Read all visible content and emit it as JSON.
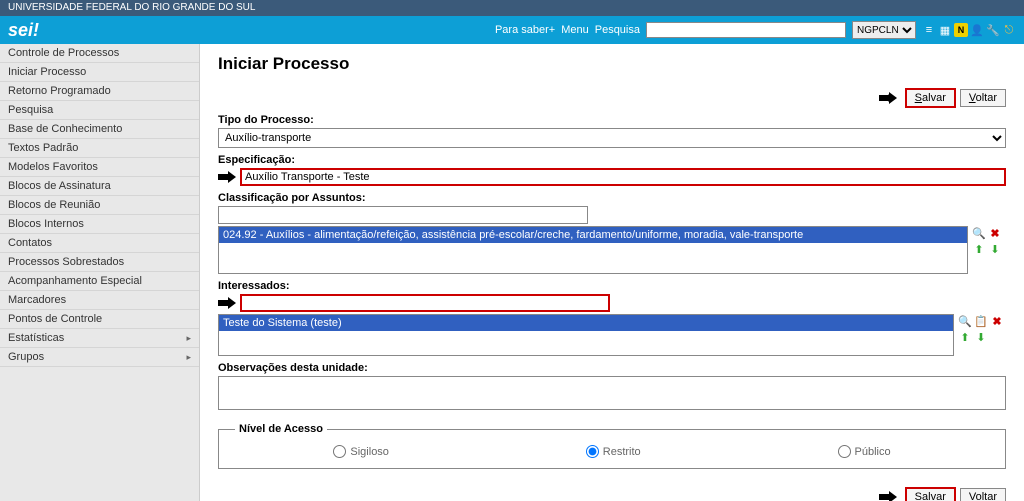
{
  "top_bar": "UNIVERSIDADE FEDERAL DO RIO GRANDE DO SUL",
  "logo": "sei",
  "header": {
    "para_saber": "Para saber+",
    "menu": "Menu",
    "pesquisa": "Pesquisa",
    "user": "NGPCLN"
  },
  "sidebar": {
    "items": [
      {
        "label": "Controle de Processos",
        "expand": false
      },
      {
        "label": "Iniciar Processo",
        "expand": false
      },
      {
        "label": "Retorno Programado",
        "expand": false
      },
      {
        "label": "Pesquisa",
        "expand": false
      },
      {
        "label": "Base de Conhecimento",
        "expand": false
      },
      {
        "label": "Textos Padrão",
        "expand": false
      },
      {
        "label": "Modelos Favoritos",
        "expand": false
      },
      {
        "label": "Blocos de Assinatura",
        "expand": false
      },
      {
        "label": "Blocos de Reunião",
        "expand": false
      },
      {
        "label": "Blocos Internos",
        "expand": false
      },
      {
        "label": "Contatos",
        "expand": false
      },
      {
        "label": "Processos Sobrestados",
        "expand": false
      },
      {
        "label": "Acompanhamento Especial",
        "expand": false
      },
      {
        "label": "Marcadores",
        "expand": false
      },
      {
        "label": "Pontos de Controle",
        "expand": false
      },
      {
        "label": "Estatísticas",
        "expand": true
      },
      {
        "label": "Grupos",
        "expand": true
      }
    ]
  },
  "main": {
    "title": "Iniciar Processo",
    "salvar": "Salvar",
    "voltar": "Voltar",
    "tipo_label": "Tipo do Processo:",
    "tipo_value": "Auxílio-transporte",
    "espec_label": "Especificação:",
    "espec_value": "Auxílio Transporte - Teste",
    "classif_label": "Classificação por Assuntos:",
    "classif_item": "024.92 - Auxílios - alimentação/refeição, assistência pré-escolar/creche, fardamento/uniforme, moradia, vale-transporte",
    "interess_label": "Interessados:",
    "interess_item": "Teste do Sistema (teste)",
    "obs_label": "Observações desta unidade:",
    "nivel_legend": "Nível de Acesso",
    "sigiloso": "Sigiloso",
    "restrito": "Restrito",
    "publico": "Público"
  }
}
